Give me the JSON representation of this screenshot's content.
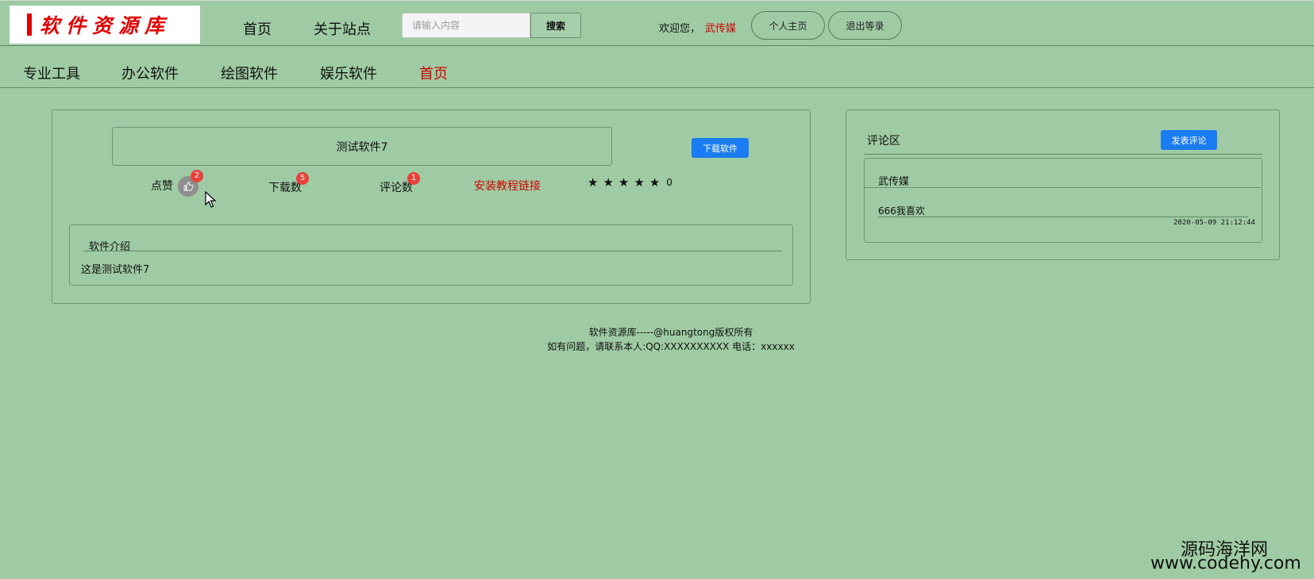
{
  "header": {
    "logo_text": "软件资源库",
    "nav": [
      "首页",
      "关于站点"
    ],
    "search_placeholder": "请输入内容",
    "search_button": "搜索",
    "welcome": "欢迎您，",
    "username": "武传媒",
    "profile_button": "个人主页",
    "logout_button": "退出等录"
  },
  "categories": [
    "专业工具",
    "办公软件",
    "绘图软件",
    "娱乐软件",
    "首页"
  ],
  "active_category": "首页",
  "software": {
    "title": "测试软件7",
    "download_button": "下载软件",
    "like_label": "点赞",
    "like_count": "2",
    "download_label": "下载数",
    "download_count": "5",
    "comment_label": "评论数",
    "comment_count": "1",
    "tutorial_link": "安装教程链接",
    "rating": "0",
    "intro_heading": "软件介绍",
    "intro_text": "这是测试软件7"
  },
  "comments": {
    "heading": "评论区",
    "post_button": "发表评论",
    "items": [
      {
        "user": "武传媒",
        "text": "666我喜欢",
        "time": "2020-05-09 21:12:44"
      }
    ]
  },
  "footer": {
    "line1": "软件资源库-----@huangtong版权所有",
    "line2": "如有问题，请联系本人:QQ:XXXXXXXXXX 电话：xxxxxx"
  },
  "watermark": {
    "line1": "源码海洋网",
    "line2": "www.codehy.com"
  },
  "colors": {
    "background": "#9ecba3",
    "accent_red": "#d30000",
    "button_blue": "#1a7cf2",
    "badge_red": "#e8413a"
  }
}
